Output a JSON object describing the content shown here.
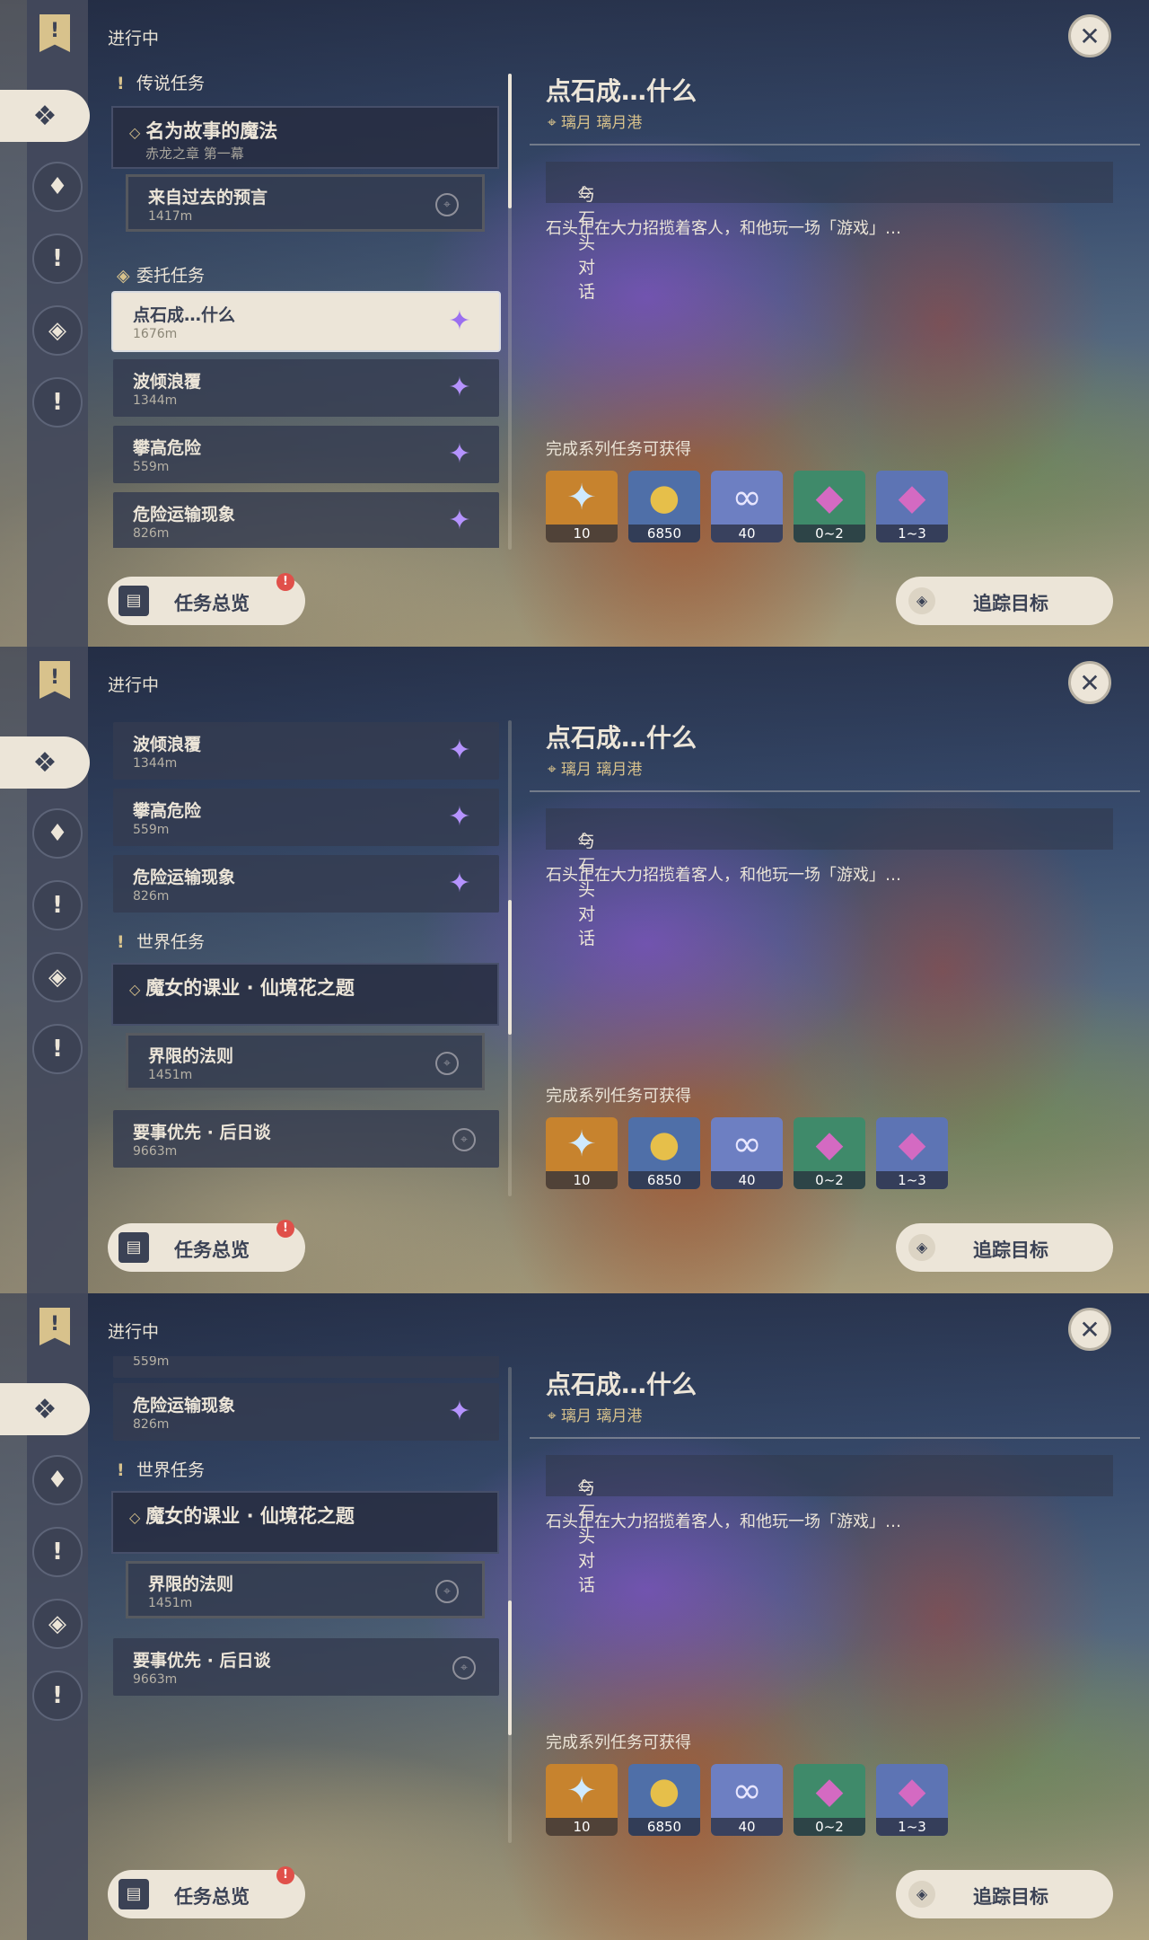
{
  "common": {
    "status_label": "进行中",
    "close_glyph": "✕",
    "detail_title": "点石成…什么",
    "location": "璃月 璃月港",
    "step_label": "与石头对话",
    "description": "石头正在大力招揽着客人，和他玩一场「游戏」…",
    "rewards_label": "完成系列任务可获得",
    "rewards": [
      {
        "icon": "primogem-icon",
        "glyph": "✦",
        "qty": "10",
        "bg": "#c7832e",
        "color": "#cfeaff"
      },
      {
        "icon": "mora-coin-icon",
        "glyph": "●",
        "qty": "6850",
        "bg": "#4f6fa8",
        "color": "#e6bf4a"
      },
      {
        "icon": "companionship-exp-icon",
        "glyph": "∞",
        "qty": "40",
        "bg": "#6d7fc2",
        "color": "#e8e6ff"
      },
      {
        "icon": "crystal-chunk-icon",
        "glyph": "◆",
        "qty": "0~2",
        "bg": "#3f8a6a",
        "color": "#d46ac2"
      },
      {
        "icon": "crystal-ore-icon",
        "glyph": "◆",
        "qty": "1~3",
        "bg": "#5d74b4",
        "color": "#d46ac2"
      }
    ],
    "overview_label": "任务总览",
    "overview_badge": "!",
    "track_label": "追踪目标"
  },
  "panel1": {
    "legend_section": "传说任务",
    "legend_parent_title": "名为故事的魔法",
    "legend_parent_sub": "赤龙之章 第一幕",
    "legend_child_title": "来自过去的预言",
    "legend_child_dist": "1417m",
    "commission_section": "委托任务",
    "items": [
      {
        "title": "点石成…什么",
        "dist": "1676m"
      },
      {
        "title": "波倾浪覆",
        "dist": "1344m"
      },
      {
        "title": "攀高危险",
        "dist": "559m"
      },
      {
        "title": "危险运输现象",
        "dist": "826m"
      }
    ]
  },
  "panel2": {
    "items": [
      {
        "title": "波倾浪覆",
        "dist": "1344m"
      },
      {
        "title": "攀高危险",
        "dist": "559m"
      },
      {
        "title": "危险运输现象",
        "dist": "826m"
      }
    ],
    "world_section": "世界任务",
    "world_parent_title": "魔女的课业 · 仙境花之题",
    "world_child_title": "界限的法则",
    "world_child_dist": "1451m",
    "extra_title": "要事优先 · 后日谈",
    "extra_dist": "9663m"
  },
  "panel3": {
    "partial_dist": "559m",
    "items": [
      {
        "title": "危险运输现象",
        "dist": "826m"
      }
    ],
    "world_section": "世界任务",
    "world_parent_title": "魔女的课业 · 仙境花之题",
    "world_child_title": "界限的法则",
    "world_child_dist": "1451m",
    "extra_title": "要事优先 · 后日谈",
    "extra_dist": "9663m"
  }
}
